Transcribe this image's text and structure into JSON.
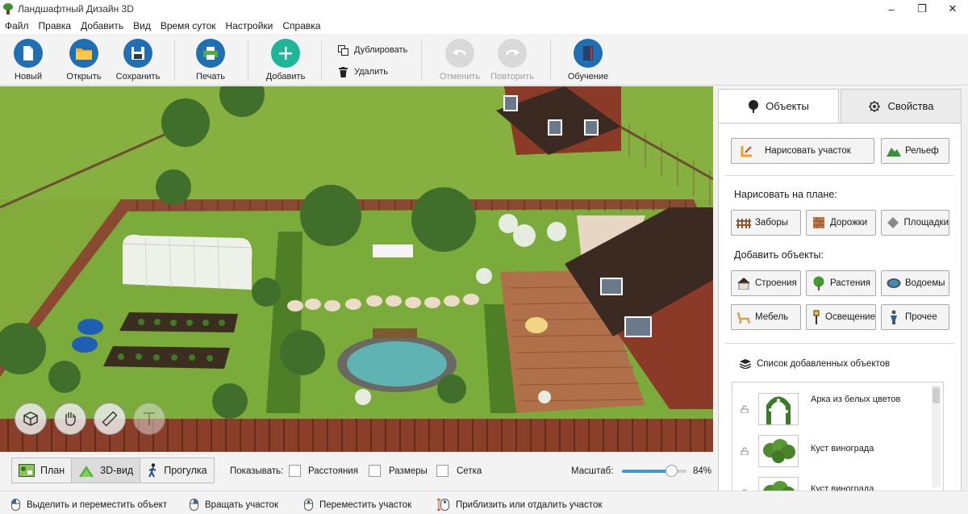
{
  "window": {
    "title": "Ландшафтный Дизайн 3D",
    "minimize": "–",
    "maximize": "❐",
    "close": "✕"
  },
  "menu": [
    "Файл",
    "Правка",
    "Добавить",
    "Вид",
    "Время суток",
    "Настройки",
    "Справка"
  ],
  "toolbar": {
    "new": "Новый",
    "open": "Открыть",
    "save": "Сохранить",
    "print": "Печать",
    "add": "Добавить",
    "duplicate": "Дублировать",
    "delete": "Удалить",
    "undo": "Отменить",
    "redo": "Повторить",
    "tutorial": "Обучение"
  },
  "panel": {
    "tabs": {
      "objects": "Объекты",
      "properties": "Свойства"
    },
    "draw_plot": "Нарисовать участок",
    "relief": "Рельеф",
    "draw_on_plan_title": "Нарисовать на плане:",
    "draw_buttons": [
      "Заборы",
      "Дорожки",
      "Площадки"
    ],
    "add_objects_title": "Добавить объекты:",
    "add_buttons": [
      "Строения",
      "Растения",
      "Водоемы",
      "Мебель",
      "Освещение",
      "Прочее"
    ],
    "list_title": "Список добавленных объектов",
    "list_items": [
      "Арка из белых цветов",
      "Куст винограда",
      "Куст винограда"
    ]
  },
  "viewbar": {
    "tabs": [
      "План",
      "3D-вид",
      "Прогулка"
    ],
    "active_tab": "3D-вид",
    "show_label": "Показывать:",
    "checkboxes": [
      "Расстояния",
      "Размеры",
      "Сетка"
    ],
    "zoom_label": "Масштаб:",
    "zoom_value": "84%",
    "zoom_fraction": 0.84
  },
  "status": [
    "Выделить и переместить объект",
    "Вращать участок",
    "Переместить участок",
    "Приблизить или отдалить участок"
  ],
  "colors": {
    "accent": "#3a9ad9",
    "grass": "#7fa63a",
    "deck": "#b0704a",
    "roof": "#3b2a22",
    "brick": "#8c3a28"
  }
}
